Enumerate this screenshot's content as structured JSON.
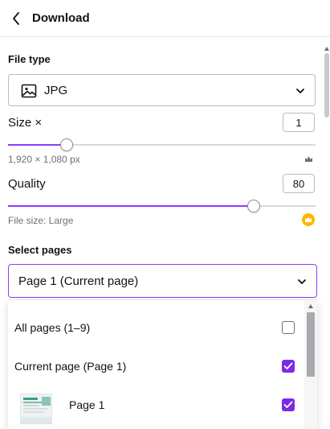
{
  "header": {
    "title": "Download"
  },
  "file_type": {
    "label": "File type",
    "value": "JPG",
    "icon": "image-icon"
  },
  "size": {
    "label": "Size ×",
    "value": "1",
    "dimensions": "1,920 × 1,080 px",
    "slider_fraction": 0.25,
    "premium_icon": "crown-icon"
  },
  "quality": {
    "label": "Quality",
    "value": "80",
    "file_size": "File size: Large",
    "slider_fraction": 0.8,
    "premium_icon": "crown-badge-icon"
  },
  "select_pages": {
    "label": "Select pages",
    "value": "Page 1 (Current page)",
    "options": [
      {
        "label": "All pages (1–9)",
        "checked": false
      },
      {
        "label": "Current page (Page 1)",
        "checked": true
      },
      {
        "label": "Page 1",
        "checked": true,
        "has_thumbnail": true
      }
    ]
  },
  "colors": {
    "accent": "#8b3dff",
    "checkbox": "#7d2ae8",
    "crown_badge": "#ffb800"
  }
}
